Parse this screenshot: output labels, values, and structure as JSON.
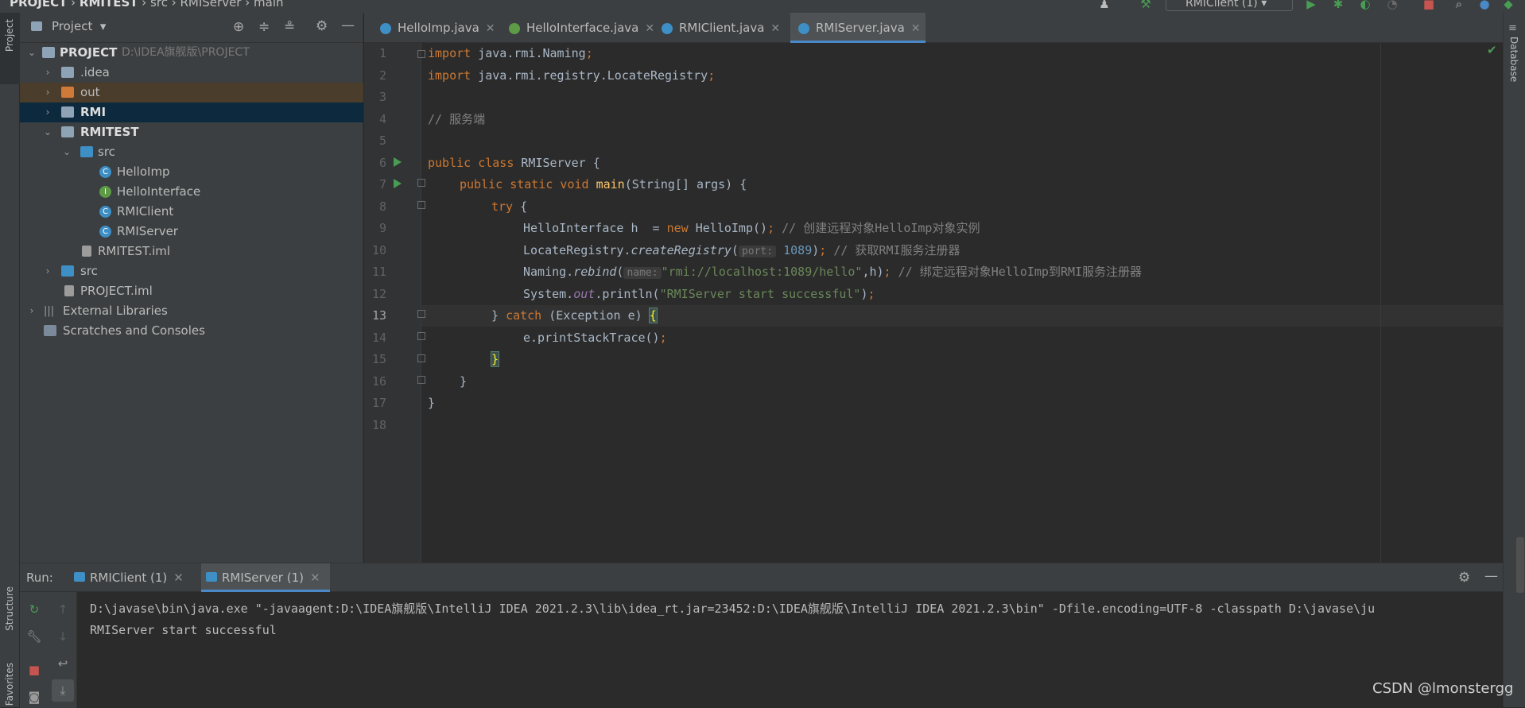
{
  "breadcrumb": [
    "PROJECT",
    "RMITEST",
    "src",
    "RMIServer",
    "main"
  ],
  "run_config": "RMIClient (1)",
  "project_panel": {
    "title": "Project",
    "tree": [
      {
        "label": "PROJECT",
        "path": "D:\\IDEA旗舰版\\PROJECT"
      },
      {
        "label": ".idea"
      },
      {
        "label": "out"
      },
      {
        "label": "RMI"
      },
      {
        "label": "RMITEST"
      },
      {
        "label": "src"
      },
      {
        "label": "HelloImp"
      },
      {
        "label": "HelloInterface"
      },
      {
        "label": "RMIClient"
      },
      {
        "label": "RMIServer"
      },
      {
        "label": "RMITEST.iml"
      },
      {
        "label": "src"
      },
      {
        "label": "PROJECT.iml"
      },
      {
        "label": "External Libraries"
      },
      {
        "label": "Scratches and Consoles"
      }
    ]
  },
  "left_stripe": {
    "project": "Project",
    "structure": "Structure",
    "favorites": "Favorites"
  },
  "right_stripe": {
    "database": "Database"
  },
  "tabs": [
    {
      "label": "HelloImp.java",
      "icon": "class-icon"
    },
    {
      "label": "HelloInterface.java",
      "icon": "interface-icon"
    },
    {
      "label": "RMIClient.java",
      "icon": "class-icon"
    },
    {
      "label": "RMIServer.java",
      "icon": "class-icon",
      "active": true
    }
  ],
  "editor": {
    "line_numbers": [
      "1",
      "2",
      "3",
      "4",
      "5",
      "6",
      "7",
      "8",
      "9",
      "10",
      "11",
      "12",
      "13",
      "14",
      "15",
      "16",
      "17",
      "18"
    ],
    "code": {
      "l1": {
        "kw": "import",
        "rest": " java.rmi.Naming",
        "semi": ";"
      },
      "l2": {
        "kw": "import",
        "rest": " java.rmi.registry.LocateRegistry",
        "semi": ";"
      },
      "l4": "// 服务端",
      "l6": {
        "kw": "public class",
        "rest": " RMIServer {"
      },
      "l7": {
        "kw": "public static void",
        "fn": "main",
        "rest": "(String[] args) {"
      },
      "l8": {
        "kw": "try",
        "rest": " {"
      },
      "l9": {
        "a": "HelloInterface h  = ",
        "kw": "new",
        "b": " HelloImp()",
        "semi": ";",
        "cm": " // 创建远程对象HelloImp对象实例"
      },
      "l10": {
        "a": "LocateRegistry.",
        "fn": "createRegistry",
        "b": "(",
        "hint": "port:",
        "num": "1089",
        "c": ")",
        "semi": ";",
        "cm": " // 获取RMI服务注册器"
      },
      "l11": {
        "a": "Naming.",
        "fn": "rebind",
        "b": "(",
        "hint": "name:",
        "st": "\"rmi://localhost:1089/hello\"",
        "c": ",h)",
        "semi": ";",
        "cm": " // 绑定远程对象HelloImp到RMI服务注册器"
      },
      "l12": {
        "a": "System.",
        "field": "out",
        "b": ".println(",
        "st": "\"RMIServer start successful\"",
        "c": ")",
        "semi": ";"
      },
      "l13": {
        "a": "} ",
        "kw": "catch",
        "b": " (Exception e) ",
        "brace": "{"
      },
      "l14": {
        "a": "e.printStackTrace()",
        "semi": ";"
      },
      "l15": {
        "brace": "}"
      },
      "l16": "}",
      "l17": "}"
    }
  },
  "run_panel": {
    "label": "Run:",
    "tabs": [
      "RMIClient (1)",
      "RMIServer (1)"
    ],
    "active_tab": "RMIServer (1)",
    "console": [
      "D:\\javase\\bin\\java.exe \"-javaagent:D:\\IDEA旗舰版\\IntelliJ IDEA 2021.2.3\\lib\\idea_rt.jar=23452:D:\\IDEA旗舰版\\IntelliJ IDEA 2021.2.3\\bin\" -Dfile.encoding=UTF-8 -classpath D:\\javase\\ju",
      "RMIServer start successful"
    ]
  },
  "watermark": "CSDN @lmonstergg",
  "colors": {
    "accent": "#4a88c7",
    "run_green": "#499c54",
    "keyword": "#cc7832",
    "string": "#6a8759",
    "comment": "#808080",
    "number": "#6897bb"
  }
}
